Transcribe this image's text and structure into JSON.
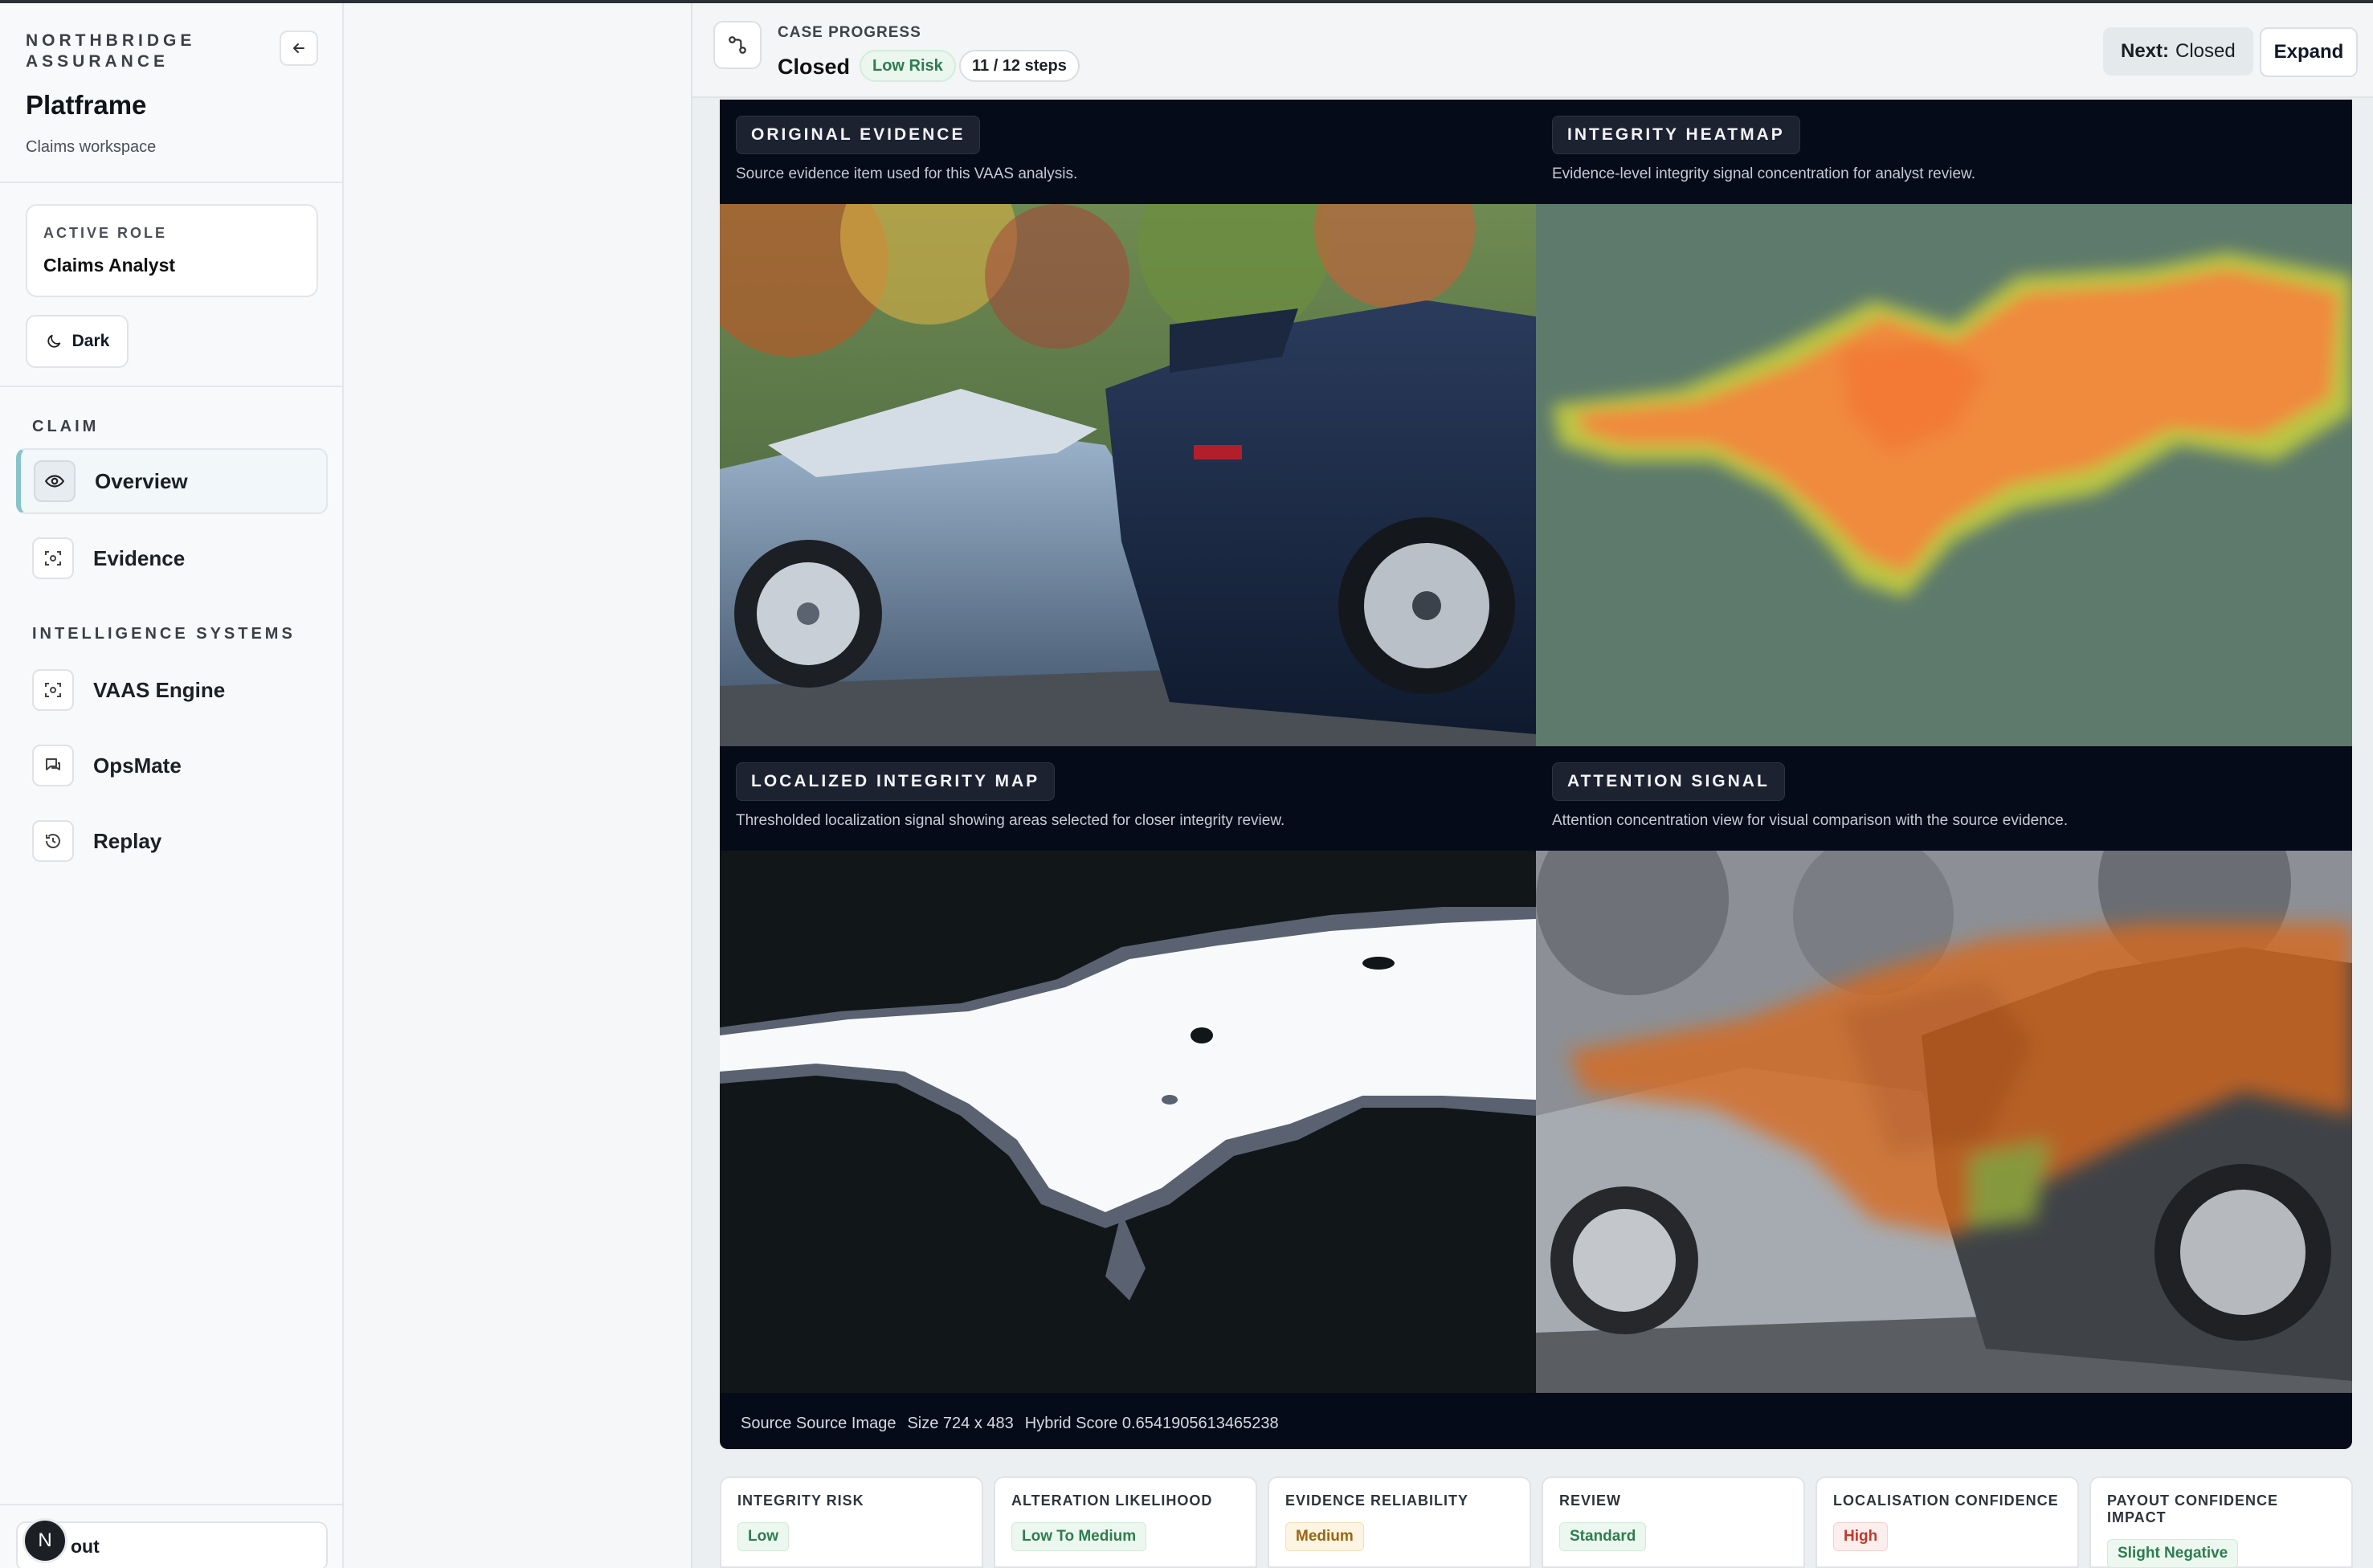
{
  "sidebar": {
    "org": "NORTHBRIDGE ASSURANCE",
    "app_name": "Platframe",
    "app_subtitle": "Claims workspace",
    "role_label": "ACTIVE ROLE",
    "role_value": "Claims Analyst",
    "theme_label": "Dark",
    "sections": [
      {
        "label": "CLAIM"
      },
      {
        "label": "INTELLIGENCE SYSTEMS"
      }
    ],
    "items": [
      {
        "label": "Overview",
        "icon": "eye-icon",
        "active": true
      },
      {
        "label": "Evidence",
        "icon": "scan-icon"
      },
      {
        "label": "VAAS Engine",
        "icon": "scan-icon"
      },
      {
        "label": "OpsMate",
        "icon": "chat-icon"
      },
      {
        "label": "Replay",
        "icon": "history-icon"
      }
    ],
    "logout_label": "out",
    "avatar_initial": "N"
  },
  "progress": {
    "label": "CASE PROGRESS",
    "status": "Closed",
    "risk_badge": "Low Risk",
    "steps": "11 / 12 steps",
    "next_prefix": "Next:",
    "next_value": "Closed",
    "expand_label": "Expand"
  },
  "panels": [
    {
      "title": "ORIGINAL EVIDENCE",
      "desc": "Source evidence item used for this VAAS analysis."
    },
    {
      "title": "INTEGRITY HEATMAP",
      "desc": "Evidence-level integrity signal concentration for analyst review."
    },
    {
      "title": "LOCALIZED INTEGRITY MAP",
      "desc": "Thresholded localization signal showing areas selected for closer integrity review."
    },
    {
      "title": "ATTENTION SIGNAL",
      "desc": "Attention concentration view for visual comparison with the source evidence."
    }
  ],
  "footer": {
    "source": "Source Source Image",
    "size": "Size 724 x 483",
    "score": "Hybrid Score 0.6541905613465238"
  },
  "metrics": [
    {
      "label": "INTEGRITY RISK",
      "value": "Low",
      "tone": "green"
    },
    {
      "label": "ALTERATION LIKELIHOOD",
      "value": "Low To Medium",
      "tone": "green"
    },
    {
      "label": "EVIDENCE RELIABILITY",
      "value": "Medium",
      "tone": "amber"
    },
    {
      "label": "REVIEW",
      "value": "Standard",
      "tone": "green"
    },
    {
      "label": "LOCALISATION CONFIDENCE",
      "value": "High",
      "tone": "red"
    },
    {
      "label": "PAYOUT CONFIDENCE IMPACT",
      "value": "Slight Negative",
      "tone": "green"
    }
  ],
  "colors": {
    "accent": "#86c3cb",
    "heat": "#f08a3c",
    "panel_bg": "#050b19"
  }
}
